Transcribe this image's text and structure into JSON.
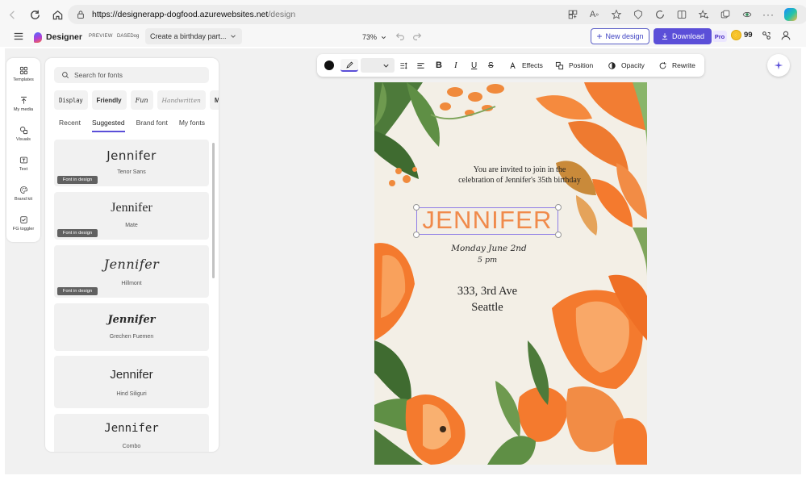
{
  "browser": {
    "url_host": "https://designerapp-dogfood.azurewebsites.net",
    "url_path": "/design"
  },
  "header": {
    "app_name": "Designer",
    "preview_tag": "PREVIEW",
    "env_tag": "DASEDog",
    "design_name": "Create a birthday part...",
    "zoom": "73%",
    "new_design_label": "New design",
    "download_label": "Download",
    "pro_label": "Pro",
    "credits": "99"
  },
  "rail": {
    "items": [
      {
        "label": "Templates",
        "icon": "templates-icon"
      },
      {
        "label": "My media",
        "icon": "upload-icon"
      },
      {
        "label": "Visuals",
        "icon": "shapes-icon"
      },
      {
        "label": "Text",
        "icon": "text-icon"
      },
      {
        "label": "Brand kit",
        "icon": "palette-icon"
      },
      {
        "label": "FG toggler",
        "icon": "checkbox-icon"
      }
    ]
  },
  "font_panel": {
    "search_placeholder": "Search for fonts",
    "chips": [
      "Display",
      "Friendly",
      "Fun",
      "Handwritten",
      "Mo"
    ],
    "tabs": [
      "Recent",
      "Suggested",
      "Brand font",
      "My fonts"
    ],
    "active_tab": "Suggested",
    "in_design_label": "Font in design",
    "fonts": [
      {
        "sample": "Jennifer",
        "name": "Tenor Sans",
        "in_design": true
      },
      {
        "sample": "Jennifer",
        "name": "Mate",
        "in_design": true
      },
      {
        "sample": "Jennifer",
        "name": "Hillmont",
        "in_design": true
      },
      {
        "sample": "Jennifer",
        "name": "Grechen Fuemen",
        "in_design": false
      },
      {
        "sample": "Jennifer",
        "name": "Hind Siliguri",
        "in_design": false
      },
      {
        "sample": "Jennifer",
        "name": "Combo",
        "in_design": false
      }
    ]
  },
  "toolbar": {
    "effects_label": "Effects",
    "position_label": "Position",
    "opacity_label": "Opacity",
    "rewrite_label": "Rewrite",
    "bold_label": "B",
    "italic_label": "I",
    "underline_label": "U",
    "strike_label": "S"
  },
  "canvas": {
    "invite_line1": "You are invited to join in the",
    "invite_line2": "celebration of Jennifer's 35th birthday",
    "name": "JENNIFER",
    "date": "Monday June 2nd",
    "time": "5 pm",
    "address_line1": "333, 3rd Ave",
    "address_line2": "Seattle"
  },
  "colors": {
    "accent": "#5b4fd8",
    "name_orange": "#f08a4b",
    "canvas_bg": "#f3efe6",
    "tulip_orange": "#f47a2e",
    "leaf_green": "#4d7a3a"
  }
}
